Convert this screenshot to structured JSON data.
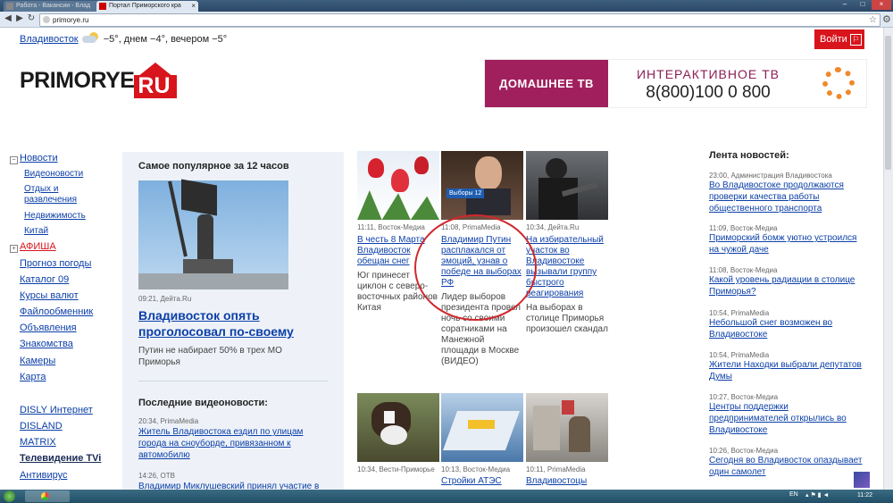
{
  "browser": {
    "tabs": [
      {
        "label": "Работа - Вакансии - Влад"
      },
      {
        "label": "Портал Приморского кра"
      }
    ],
    "url": "primorye.ru",
    "time": "11:22",
    "lang": "EN"
  },
  "header": {
    "city": "Владивосток",
    "weather": "−5°, днем −4°, вечером −5°",
    "login_label": "Войти",
    "logo_text": "PRIMORYE",
    "logo_accent": "RU",
    "banner_left": "ДОМАШНЕЕ ТВ",
    "banner_title": "ИНТЕРАКТИВНОЕ ТВ",
    "banner_phone": "8(800)100 0 800"
  },
  "nav": {
    "news": "Новости",
    "news_sub": [
      "Видеоновости",
      "Отдых и развлечения",
      "Недвижимость",
      "Китай"
    ],
    "afisha": "АФИША",
    "items": [
      "Прогноз погоды",
      "Каталог 09",
      "Курсы валют",
      "Файлообменник",
      "Объявления",
      "Знакомства",
      "Камеры",
      "Карта"
    ],
    "extra": [
      "DISLY Интернет",
      "DISLAND",
      "MATRIX",
      "Телевидение TVi",
      "Антивирус"
    ]
  },
  "popular": {
    "title": "Самое популярное за 12 часов",
    "meta": "09:21, Дейта.Ru",
    "headline": "Владивосток опять проголосовал по-своему",
    "lead": "Путин не набирает 50% в трех МО Приморья",
    "video_title": "Последние видеоновости:",
    "videos": [
      {
        "meta": "20:34, PrimaMedia",
        "title": "Житель Владивостока ездил по улицам города на сноуборде, привязанном к автомобилю"
      },
      {
        "meta": "14:26, ОТВ",
        "title": "Владимир Миклушевский принял участие в"
      }
    ]
  },
  "grid": {
    "row1": [
      {
        "meta": "11:11, Восток-Медиа",
        "title": "В честь 8 Марта Владивосток обещан снег",
        "lead": "Юг принесет циклон с северо-восточных районов Китая"
      },
      {
        "meta": "11:08, PrimaMedia",
        "title": "Владимир Путин расплакался от эмоций, узнав о победе на выборах РФ",
        "lead": "Лидер выборов президента провел ночь со своими соратниками на Манежной площади в Москве (ВИДЕО)",
        "caption": "Выборы 12"
      },
      {
        "meta": "10:34, Дейта.Ru",
        "title": "На избирательный участок во Владивостоке вызывали группу быстрого реагирования",
        "lead": "На выборах в столице Приморья произошел скандал"
      }
    ],
    "row2": [
      {
        "meta": "10:34, Вести-Приморье",
        "title": ""
      },
      {
        "meta": "10:13, Восток-Медиа",
        "title": "Стройки АТЭС"
      },
      {
        "meta": "10:11, PrimaMedia",
        "title": "Владивостоцы"
      }
    ]
  },
  "feed": {
    "title": "Лента новостей:",
    "items": [
      {
        "meta": "23:00, Администрация Владивостока",
        "title": "Во Владивостоке продолжаются проверки качества работы общественного транспорта"
      },
      {
        "meta": "11:09, Восток-Медиа",
        "title": "Приморский бомж уютно устроился на чужой даче"
      },
      {
        "meta": "11:08, Восток-Медиа",
        "title": "Какой уровень радиации в столице Приморья?"
      },
      {
        "meta": "10:54, PrimaMedia",
        "title": "Небольшой снег возможен во Владивостоке"
      },
      {
        "meta": "10:54, PrimaMedia",
        "title": "Жители Находки выбрали депутатов Думы"
      },
      {
        "meta": "10:27, Восток-Медиа",
        "title": "Центры поддержки предпринимателей открылись во Владивостоке"
      },
      {
        "meta": "10:26, Восток-Медиа",
        "title": "Сегодня во Владивосток опаздывает один самолет"
      }
    ]
  },
  "colors": {
    "brand_red": "#d8141c",
    "link": "#0b3fa8",
    "banner_purple": "#a0205d",
    "annotation_red": "#d0282d"
  }
}
